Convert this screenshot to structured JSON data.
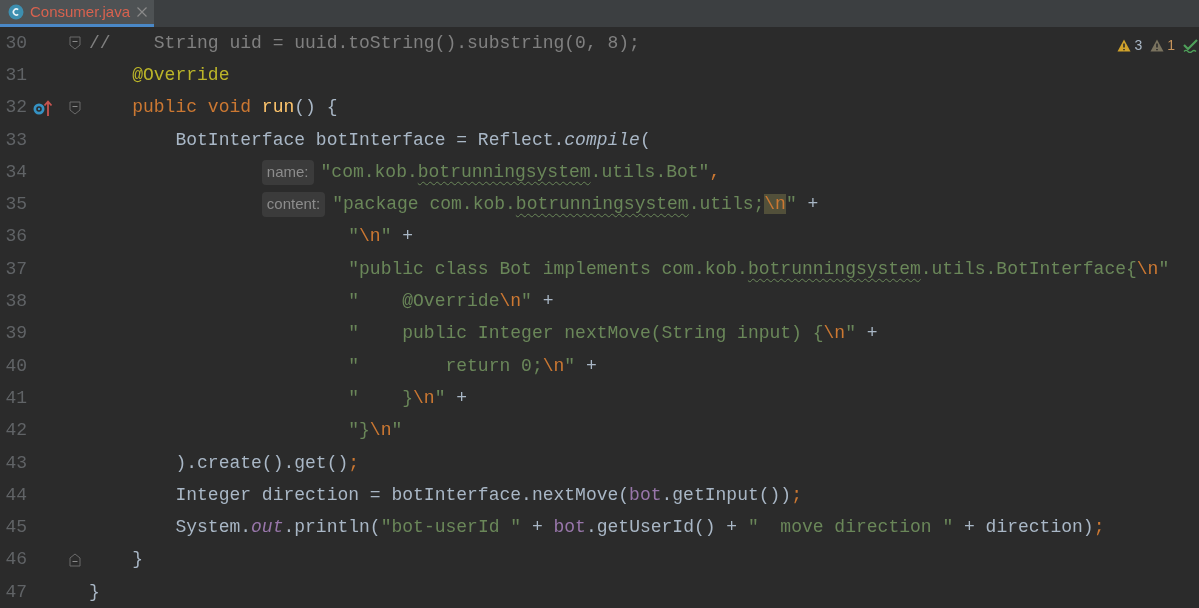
{
  "tabs": [
    {
      "label": "Consumer.java",
      "selected": true
    }
  ],
  "inspections": {
    "warnings": "3",
    "weak_warnings": "1"
  },
  "lines": [
    {
      "number": "30",
      "gutter": [
        {
          "kind": "fold_start"
        }
      ],
      "tokens": [
        {
          "kind": "comment",
          "text": "//    String uid = uuid.toString().substring(0, 8);"
        }
      ]
    },
    {
      "number": "31",
      "tokens": [
        {
          "kind": "annotation",
          "text": "    @Override"
        }
      ]
    },
    {
      "number": "32",
      "gutter": [
        {
          "kind": "override"
        },
        {
          "kind": "fold_start"
        }
      ],
      "tokens": [
        {
          "kind": "keyword",
          "text": "    public void "
        },
        {
          "kind": "method",
          "text": "run"
        },
        {
          "kind": "plain",
          "text": "() {"
        }
      ]
    },
    {
      "number": "33",
      "tokens": [
        {
          "kind": "plain",
          "text": "        BotInterface botInterface = Reflect."
        },
        {
          "kind": "italic",
          "text": "compile"
        },
        {
          "kind": "plain",
          "text": "("
        }
      ]
    },
    {
      "number": "34",
      "tokens": [
        {
          "kind": "hint",
          "text": "                name:"
        },
        {
          "kind": "string",
          "text": "\"com.kob."
        },
        {
          "kind": "typo",
          "text": "botrunningsystem"
        },
        {
          "kind": "string",
          "text": ".utils.Bot\""
        },
        {
          "kind": "keyword",
          "text": ","
        }
      ]
    },
    {
      "number": "35",
      "tokens": [
        {
          "kind": "hint",
          "text": "                content:"
        },
        {
          "kind": "string",
          "text": "\"package com.kob."
        },
        {
          "kind": "typo",
          "text": "botrunningsystem"
        },
        {
          "kind": "string",
          "text": ".utils;"
        },
        {
          "kind": "escape_hl",
          "text": "\\n"
        },
        {
          "kind": "string",
          "text": "\""
        },
        {
          "kind": "plain",
          "text": " +"
        }
      ]
    },
    {
      "number": "36",
      "tokens": [
        {
          "kind": "string",
          "text": "                        \""
        },
        {
          "kind": "escape",
          "text": "\\n"
        },
        {
          "kind": "string",
          "text": "\""
        },
        {
          "kind": "plain",
          "text": " +"
        }
      ]
    },
    {
      "number": "37",
      "tokens": [
        {
          "kind": "string",
          "text": "                        \"public class Bot implements com.kob."
        },
        {
          "kind": "typo",
          "text": "botrunningsystem"
        },
        {
          "kind": "string",
          "text": ".utils.BotInterface{"
        },
        {
          "kind": "escape",
          "text": "\\n"
        },
        {
          "kind": "string",
          "text": "\""
        }
      ]
    },
    {
      "number": "38",
      "tokens": [
        {
          "kind": "string",
          "text": "                        \"    @Override"
        },
        {
          "kind": "escape",
          "text": "\\n"
        },
        {
          "kind": "string",
          "text": "\""
        },
        {
          "kind": "plain",
          "text": " +"
        }
      ]
    },
    {
      "number": "39",
      "tokens": [
        {
          "kind": "string",
          "text": "                        \"    public Integer nextMove(String input) {"
        },
        {
          "kind": "escape",
          "text": "\\n"
        },
        {
          "kind": "string",
          "text": "\""
        },
        {
          "kind": "plain",
          "text": " +"
        }
      ]
    },
    {
      "number": "40",
      "tokens": [
        {
          "kind": "string",
          "text": "                        \"        return 0;"
        },
        {
          "kind": "escape",
          "text": "\\n"
        },
        {
          "kind": "string",
          "text": "\""
        },
        {
          "kind": "plain",
          "text": " +"
        }
      ]
    },
    {
      "number": "41",
      "tokens": [
        {
          "kind": "string",
          "text": "                        \"    }"
        },
        {
          "kind": "escape",
          "text": "\\n"
        },
        {
          "kind": "string",
          "text": "\""
        },
        {
          "kind": "plain",
          "text": " +"
        }
      ]
    },
    {
      "number": "42",
      "tokens": [
        {
          "kind": "string",
          "text": "                        \"}"
        },
        {
          "kind": "escape",
          "text": "\\n"
        },
        {
          "kind": "string",
          "text": "\""
        }
      ]
    },
    {
      "number": "43",
      "tokens": [
        {
          "kind": "plain",
          "text": "        ).create().get()"
        },
        {
          "kind": "keyword",
          "text": ";"
        }
      ]
    },
    {
      "number": "44",
      "tokens": [
        {
          "kind": "plain",
          "text": "        Integer direction = botInterface.nextMove("
        },
        {
          "kind": "field",
          "text": "bot"
        },
        {
          "kind": "plain",
          "text": ".getInput())"
        },
        {
          "kind": "keyword",
          "text": ";"
        }
      ]
    },
    {
      "number": "45",
      "tokens": [
        {
          "kind": "plain",
          "text": "        System."
        },
        {
          "kind": "static",
          "text": "out"
        },
        {
          "kind": "plain",
          "text": ".println("
        },
        {
          "kind": "string",
          "text": "\"bot-userId \""
        },
        {
          "kind": "plain",
          "text": " + "
        },
        {
          "kind": "field",
          "text": "bot"
        },
        {
          "kind": "plain",
          "text": ".getUserId() + "
        },
        {
          "kind": "string",
          "text": "\"  move direction \""
        },
        {
          "kind": "plain",
          "text": " + direction)"
        },
        {
          "kind": "keyword",
          "text": ";"
        }
      ]
    },
    {
      "number": "46",
      "gutter": [
        {
          "kind": "fold_end"
        }
      ],
      "tokens": [
        {
          "kind": "plain",
          "text": "    }"
        }
      ]
    },
    {
      "number": "47",
      "tokens": [
        {
          "kind": "plain",
          "text": "}"
        }
      ]
    }
  ]
}
